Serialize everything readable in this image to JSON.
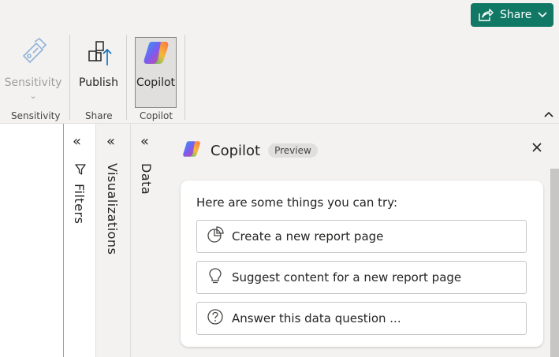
{
  "topbar": {
    "share_label": "Share",
    "share_icon": "share-icon",
    "chevron_icon": "chevron-down-icon",
    "accent_color": "#117865"
  },
  "ribbon": {
    "groups": [
      {
        "button_label": "Sensitivity",
        "group_label": "Sensitivity",
        "icon": "sensitivity-label-icon",
        "enabled": false
      },
      {
        "button_label": "Publish",
        "group_label": "Share",
        "icon": "publish-icon",
        "enabled": true
      },
      {
        "button_label": "Copilot",
        "group_label": "Copilot",
        "icon": "copilot-logo-icon",
        "enabled": true,
        "selected": true
      }
    ],
    "collapse_icon": "chevron-up-icon"
  },
  "panes": {
    "filters_label": "Filters",
    "visualizations_label": "Visualizations",
    "data_label": "Data"
  },
  "copilot": {
    "title": "Copilot",
    "badge": "Preview",
    "intro": "Here are some things you can try:",
    "suggestions": [
      {
        "label": "Create a new report page",
        "icon": "pie-chart-icon"
      },
      {
        "label": "Suggest content for a new report page",
        "icon": "lightbulb-icon"
      },
      {
        "label": "Answer this data question ...",
        "icon": "question-icon"
      }
    ]
  }
}
